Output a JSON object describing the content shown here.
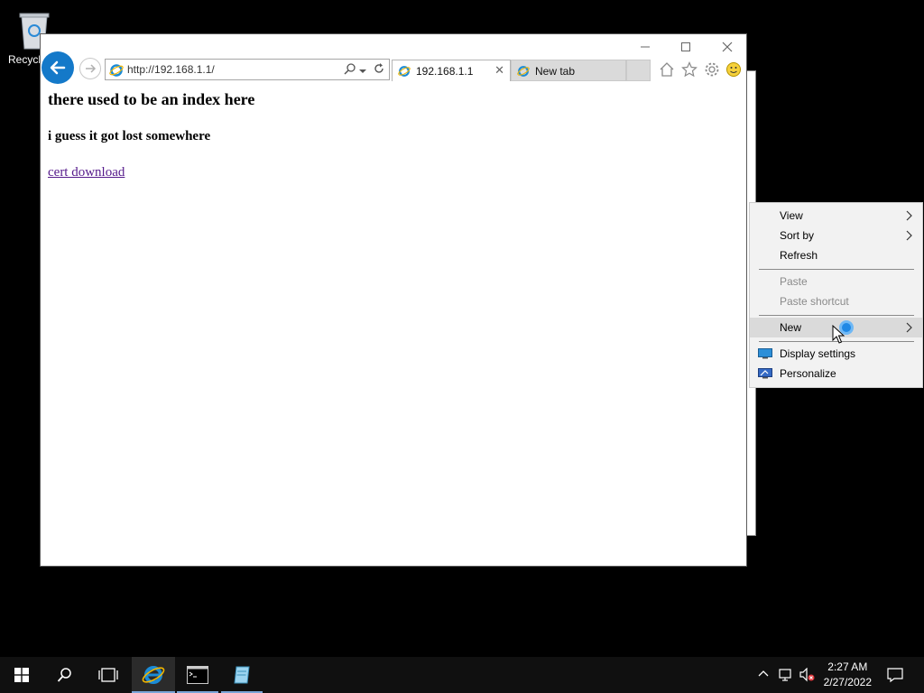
{
  "desktop": {
    "recycle_bin_label": "Recycl"
  },
  "browser": {
    "address_url": "http://192.168.1.1/",
    "tabs": [
      {
        "label": "192.168.1.1",
        "active": true
      },
      {
        "label": "New tab",
        "active": false
      }
    ],
    "page": {
      "heading": "there used to be an index here",
      "subheading": "i guess it got lost somewhere",
      "link_text": "cert download"
    }
  },
  "context_menu": {
    "items": [
      {
        "label": "View",
        "submenu": true,
        "enabled": true
      },
      {
        "label": "Sort by",
        "submenu": true,
        "enabled": true
      },
      {
        "label": "Refresh",
        "submenu": false,
        "enabled": true
      },
      {
        "label": "Paste",
        "submenu": false,
        "enabled": false
      },
      {
        "label": "Paste shortcut",
        "submenu": false,
        "enabled": false
      },
      {
        "label": "New",
        "submenu": true,
        "enabled": true,
        "highlighted": true
      },
      {
        "label": "Display settings",
        "submenu": false,
        "enabled": true,
        "icon": "display-icon"
      },
      {
        "label": "Personalize",
        "submenu": false,
        "enabled": true,
        "icon": "personalize-icon"
      }
    ]
  },
  "taskbar": {
    "time": "2:27 AM",
    "date": "2/27/2022",
    "pinned": [
      "start-icon",
      "search-icon",
      "task-view-icon",
      "internet-explorer-icon",
      "command-prompt-icon",
      "notepad-icon"
    ]
  },
  "colors": {
    "accent": "#1479c9",
    "link_visited": "#551a8b",
    "menu_bg": "#f2f2f2",
    "taskbar_bg": "#101010"
  }
}
